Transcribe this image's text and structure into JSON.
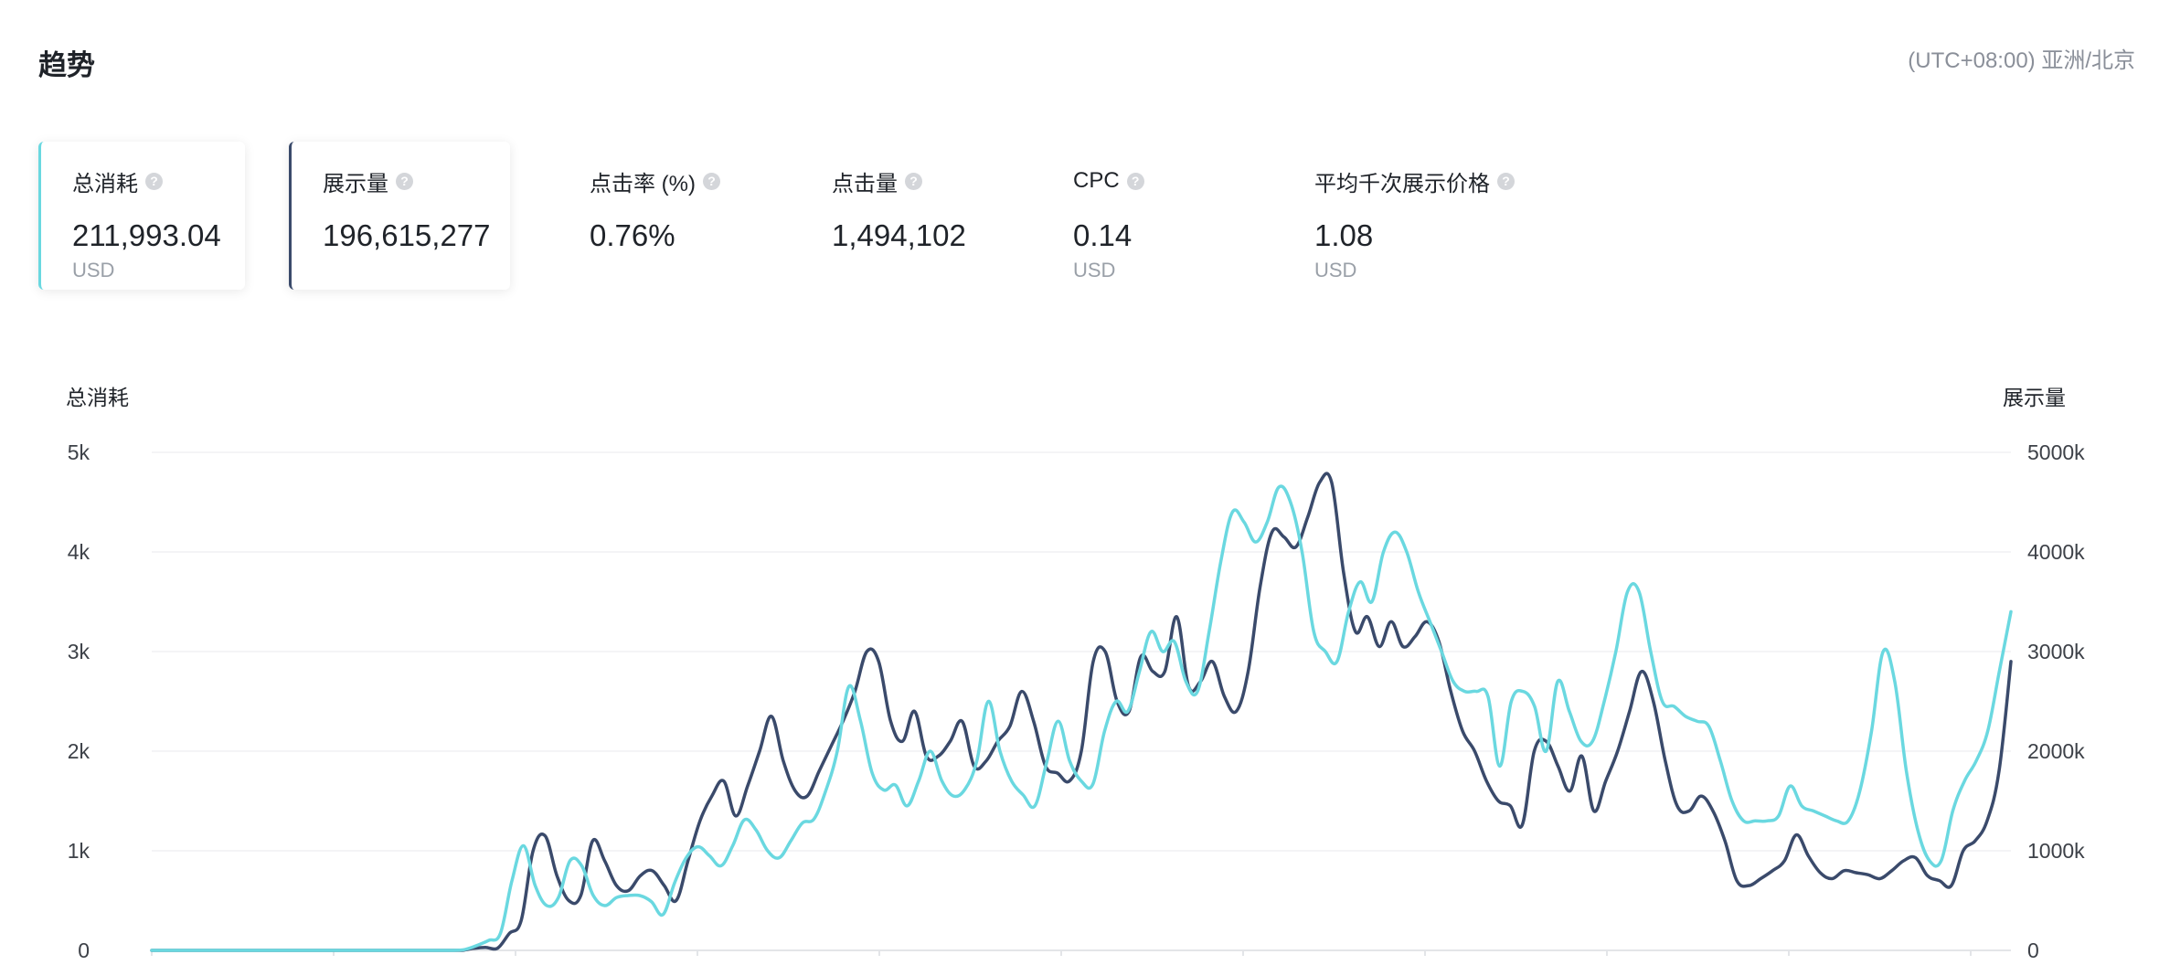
{
  "header": {
    "title": "趋势",
    "timezone": "(UTC+08:00) 亚洲/北京"
  },
  "metrics": [
    {
      "label": "总消耗",
      "value": "211,993.04",
      "unit": "USD",
      "selected": true,
      "color": "#6ad8e0"
    },
    {
      "label": "展示量",
      "value": "196,615,277",
      "unit": "",
      "selected": true,
      "color": "#3a4a6b"
    },
    {
      "label": "点击率 (%)",
      "value": "0.76%",
      "unit": "",
      "selected": false
    },
    {
      "label": "点击量",
      "value": "1,494,102",
      "unit": "",
      "selected": false
    },
    {
      "label": "CPC",
      "value": "0.14",
      "unit": "USD",
      "selected": false
    },
    {
      "label": "平均千次展示价格",
      "value": "1.08",
      "unit": "USD",
      "selected": false
    }
  ],
  "help_glyph": "?",
  "chart_data": {
    "type": "line",
    "ylabel_left": "总消耗",
    "ylabel_right": "展示量",
    "yticks_left": [
      "0",
      "1k",
      "2k",
      "3k",
      "4k",
      "5k"
    ],
    "yticks_right": [
      "0",
      "1000k",
      "2000k",
      "3000k",
      "4000k",
      "5000k"
    ],
    "ylim_left": [
      0,
      5000
    ],
    "ylim_right": [
      0,
      5000000
    ],
    "grid": true,
    "series": [
      {
        "name": "总消耗",
        "axis": "left",
        "color": "#6ad8e0",
        "values": [
          0,
          0,
          0,
          0,
          0,
          0,
          0,
          0,
          0,
          0,
          0,
          0,
          0,
          0,
          0,
          0,
          0,
          0,
          0,
          0,
          0,
          0,
          0,
          0,
          0,
          0,
          0,
          10,
          50,
          100,
          170,
          700,
          1050,
          650,
          450,
          530,
          900,
          850,
          550,
          450,
          530,
          550,
          550,
          490,
          360,
          680,
          930,
          1040,
          950,
          850,
          1050,
          1310,
          1210,
          1000,
          930,
          1100,
          1280,
          1320,
          1600,
          2000,
          2650,
          2300,
          1780,
          1610,
          1660,
          1450,
          1700,
          2000,
          1700,
          1550,
          1620,
          1900,
          2500,
          2000,
          1700,
          1560,
          1450,
          1880,
          2300,
          1900,
          1700,
          1670,
          2200,
          2500,
          2400,
          2800,
          3200,
          3000,
          3100,
          2700,
          2600,
          3200,
          3900,
          4400,
          4300,
          4100,
          4300,
          4650,
          4500,
          4000,
          3200,
          3000,
          2900,
          3400,
          3700,
          3500,
          4000,
          4200,
          4000,
          3600,
          3300,
          3000,
          2700,
          2600,
          2600,
          2550,
          1850,
          2500,
          2600,
          2450,
          2000,
          2700,
          2400,
          2100,
          2100,
          2500,
          3000,
          3600,
          3600,
          3000,
          2500,
          2450,
          2350,
          2300,
          2250,
          1900,
          1500,
          1300,
          1300,
          1300,
          1350,
          1650,
          1450,
          1400,
          1350,
          1300,
          1300,
          1600,
          2200,
          3000,
          2700,
          1800,
          1200,
          900,
          900,
          1400,
          1700,
          1900,
          2200,
          2800,
          3400
        ]
      },
      {
        "name": "展示量",
        "axis": "right",
        "color": "#3a4a6b",
        "values": [
          0,
          0,
          0,
          0,
          0,
          0,
          0,
          0,
          0,
          0,
          0,
          0,
          0,
          0,
          0,
          0,
          0,
          0,
          0,
          0,
          0,
          0,
          0,
          0,
          0,
          0,
          0,
          20000,
          30000,
          20000,
          170000,
          300000,
          1000000,
          1150000,
          750000,
          500000,
          550000,
          1100000,
          900000,
          650000,
          600000,
          750000,
          800000,
          650000,
          500000,
          900000,
          1300000,
          1550000,
          1700000,
          1350000,
          1650000,
          2000000,
          2350000,
          1900000,
          1600000,
          1550000,
          1800000,
          2050000,
          2300000,
          2600000,
          3000000,
          2900000,
          2300000,
          2100000,
          2400000,
          1950000,
          1950000,
          2100000,
          2300000,
          1850000,
          1900000,
          2100000,
          2250000,
          2600000,
          2300000,
          1850000,
          1780000,
          1700000,
          2000000,
          2900000,
          3000000,
          2500000,
          2400000,
          2950000,
          2800000,
          2800000,
          3350000,
          2650000,
          2700000,
          2900000,
          2550000,
          2400000,
          2800000,
          3650000,
          4200000,
          4150000,
          4050000,
          4350000,
          4700000,
          4700000,
          3800000,
          3200000,
          3350000,
          3050000,
          3300000,
          3050000,
          3150000,
          3300000,
          3100000,
          2600000,
          2200000,
          2000000,
          1700000,
          1500000,
          1450000,
          1260000,
          2000000,
          2100000,
          1850000,
          1600000,
          1950000,
          1400000,
          1700000,
          2000000,
          2400000,
          2800000,
          2500000,
          1900000,
          1450000,
          1400000,
          1550000,
          1400000,
          1100000,
          700000,
          650000,
          720000,
          800000,
          900000,
          1160000,
          950000,
          780000,
          720000,
          800000,
          780000,
          760000,
          720000,
          800000,
          900000,
          930000,
          750000,
          700000,
          650000,
          1000000,
          1100000,
          1300000,
          1800000,
          2900000
        ]
      }
    ]
  }
}
